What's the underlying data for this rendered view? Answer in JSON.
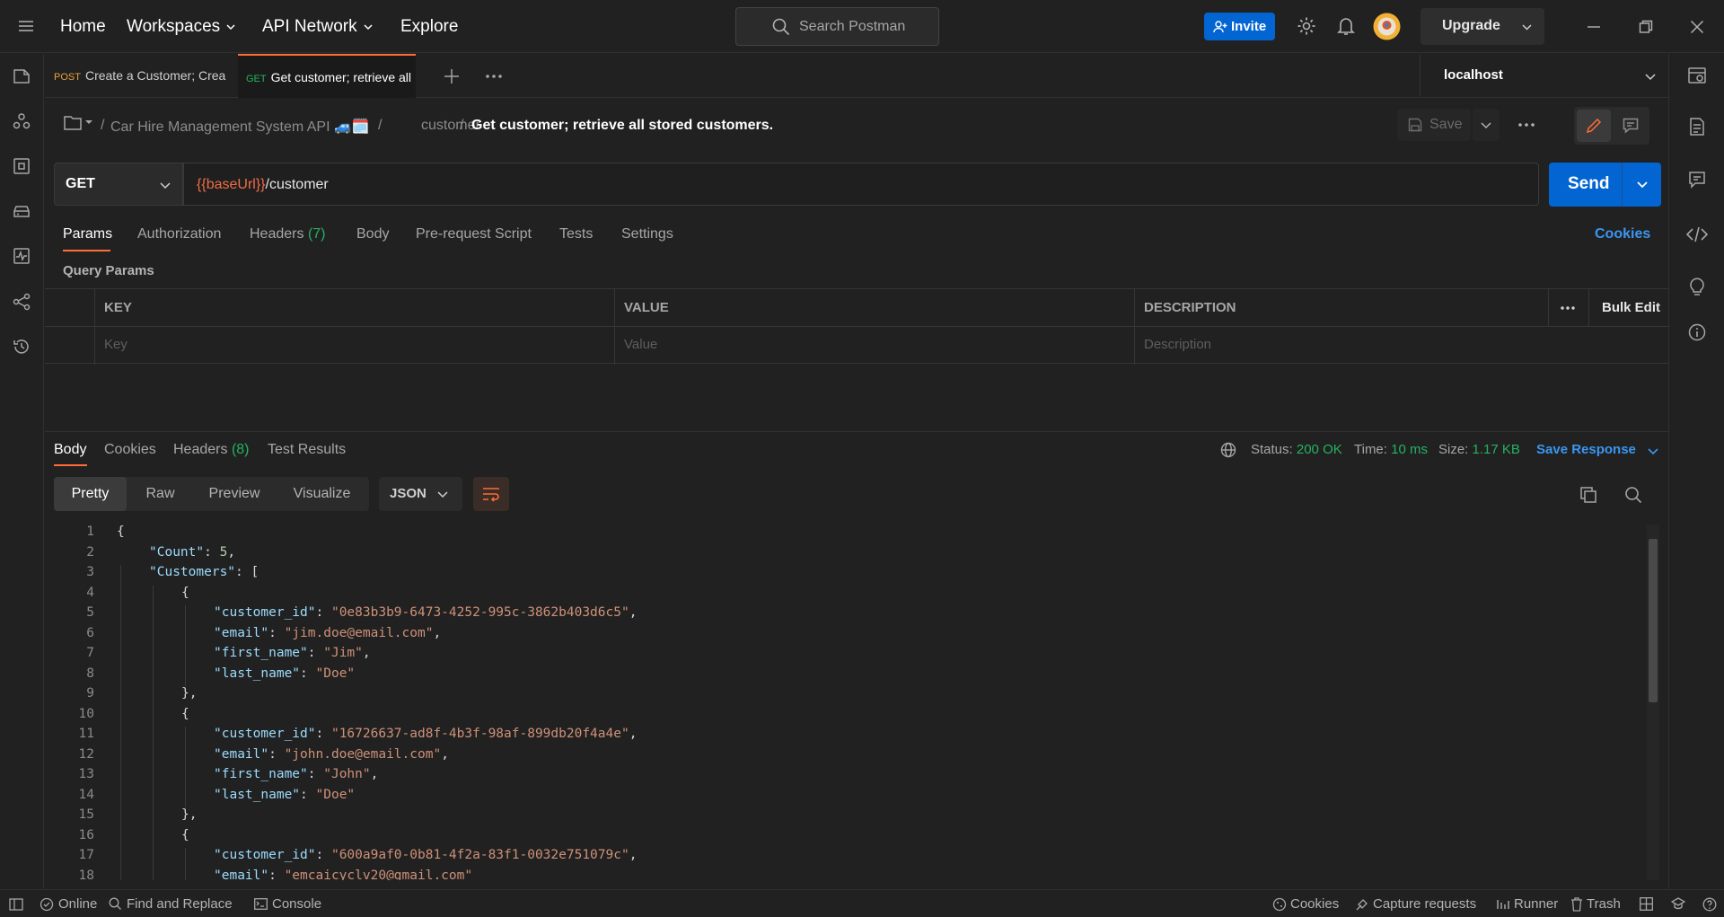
{
  "header": {
    "nav": [
      "Home",
      "Workspaces",
      "API Network",
      "Explore"
    ],
    "search_placeholder": "Search Postman",
    "invite_label": "Invite",
    "upgrade_label": "Upgrade"
  },
  "tabs": [
    {
      "method": "POST",
      "label": "Create a Customer; Crea",
      "method_color": "#e8a03f"
    },
    {
      "method": "GET",
      "label": "Get customer; retrieve all",
      "method_color": "#24b360"
    }
  ],
  "environment": "localhost",
  "breadcrumb": {
    "collection": "Car Hire Management System API 🚙🗓️",
    "folder": "customer",
    "request": "Get customer; retrieve all stored customers."
  },
  "toolbar": {
    "save_label": "Save"
  },
  "request": {
    "method": "GET",
    "url_var": "{{baseUrl}}",
    "url_path": "/customer",
    "send_label": "Send"
  },
  "request_tabs": [
    "Params",
    "Authorization",
    "Headers",
    "(7)",
    "Body",
    "Pre-request Script",
    "Tests",
    "Settings"
  ],
  "cookies_link": "Cookies",
  "params": {
    "title": "Query Params",
    "headers": [
      "KEY",
      "VALUE",
      "DESCRIPTION"
    ],
    "bulk_edit": "Bulk Edit",
    "placeholders": [
      "Key",
      "Value",
      "Description"
    ]
  },
  "response": {
    "tabs": [
      "Body",
      "Cookies",
      "Headers",
      "(8)",
      "Test Results"
    ],
    "status_label": "Status:",
    "status_value": "200 OK",
    "time_label": "Time:",
    "time_value": "10 ms",
    "size_label": "Size:",
    "size_value": "1.17 KB",
    "save_response": "Save Response",
    "views": [
      "Pretty",
      "Raw",
      "Preview",
      "Visualize"
    ],
    "format": "JSON"
  },
  "code_lines": [
    {
      "n": "1",
      "indent": 0,
      "parts": [
        [
          "p",
          "{"
        ]
      ]
    },
    {
      "n": "2",
      "indent": 1,
      "parts": [
        [
          "k",
          "\"Count\""
        ],
        [
          "p",
          ": "
        ],
        [
          "n",
          "5"
        ],
        [
          "p",
          ","
        ]
      ]
    },
    {
      "n": "3",
      "indent": 1,
      "parts": [
        [
          "k",
          "\"Customers\""
        ],
        [
          "p",
          ": ["
        ]
      ]
    },
    {
      "n": "4",
      "indent": 2,
      "parts": [
        [
          "p",
          "{"
        ]
      ]
    },
    {
      "n": "5",
      "indent": 3,
      "parts": [
        [
          "k",
          "\"customer_id\""
        ],
        [
          "p",
          ": "
        ],
        [
          "s",
          "\"0e83b3b9-6473-4252-995c-3862b403d6c5\""
        ],
        [
          "p",
          ","
        ]
      ]
    },
    {
      "n": "6",
      "indent": 3,
      "parts": [
        [
          "k",
          "\"email\""
        ],
        [
          "p",
          ": "
        ],
        [
          "s",
          "\"jim.doe@email.com\""
        ],
        [
          "p",
          ","
        ]
      ]
    },
    {
      "n": "7",
      "indent": 3,
      "parts": [
        [
          "k",
          "\"first_name\""
        ],
        [
          "p",
          ": "
        ],
        [
          "s",
          "\"Jim\""
        ],
        [
          "p",
          ","
        ]
      ]
    },
    {
      "n": "8",
      "indent": 3,
      "parts": [
        [
          "k",
          "\"last_name\""
        ],
        [
          "p",
          ": "
        ],
        [
          "s",
          "\"Doe\""
        ]
      ]
    },
    {
      "n": "9",
      "indent": 2,
      "parts": [
        [
          "p",
          "},"
        ]
      ]
    },
    {
      "n": "10",
      "indent": 2,
      "parts": [
        [
          "p",
          "{"
        ]
      ]
    },
    {
      "n": "11",
      "indent": 3,
      "parts": [
        [
          "k",
          "\"customer_id\""
        ],
        [
          "p",
          ": "
        ],
        [
          "s",
          "\"16726637-ad8f-4b3f-98af-899db20f4a4e\""
        ],
        [
          "p",
          ","
        ]
      ]
    },
    {
      "n": "12",
      "indent": 3,
      "parts": [
        [
          "k",
          "\"email\""
        ],
        [
          "p",
          ": "
        ],
        [
          "s",
          "\"john.doe@email.com\""
        ],
        [
          "p",
          ","
        ]
      ]
    },
    {
      "n": "13",
      "indent": 3,
      "parts": [
        [
          "k",
          "\"first_name\""
        ],
        [
          "p",
          ": "
        ],
        [
          "s",
          "\"John\""
        ],
        [
          "p",
          ","
        ]
      ]
    },
    {
      "n": "14",
      "indent": 3,
      "parts": [
        [
          "k",
          "\"last_name\""
        ],
        [
          "p",
          ": "
        ],
        [
          "s",
          "\"Doe\""
        ]
      ]
    },
    {
      "n": "15",
      "indent": 2,
      "parts": [
        [
          "p",
          "},"
        ]
      ]
    },
    {
      "n": "16",
      "indent": 2,
      "parts": [
        [
          "p",
          "{"
        ]
      ]
    },
    {
      "n": "17",
      "indent": 3,
      "parts": [
        [
          "k",
          "\"customer_id\""
        ],
        [
          "p",
          ": "
        ],
        [
          "s",
          "\"600a9af0-0b81-4f2a-83f1-0032e751079c\""
        ],
        [
          "p",
          ","
        ]
      ]
    },
    {
      "n": "18",
      "indent": 3,
      "parts": [
        [
          "k",
          "\"email\""
        ],
        [
          "p",
          ": "
        ],
        [
          "s",
          "\"emcaicyclv20@gmail.com\""
        ]
      ]
    }
  ],
  "statusbar": {
    "online": "Online",
    "find_replace": "Find and Replace",
    "console": "Console",
    "cookies": "Cookies",
    "capture": "Capture requests",
    "runner": "Runner",
    "trash": "Trash"
  },
  "colors": {
    "accent": "#ff6c37",
    "primary_button": "#0265d2",
    "status_ok": "#24b360",
    "json_key": "#9cdcfe",
    "json_string": "#ce9178",
    "json_number": "#b5cea8"
  },
  "icons": [
    "menu-icon",
    "search-icon",
    "settings-icon",
    "bell-icon",
    "avatar",
    "minimize-icon",
    "restore-icon",
    "close-icon",
    "collections-icon",
    "apis-icon",
    "environments-icon",
    "mock-servers-icon",
    "monitors-icon",
    "flows-icon",
    "history-icon",
    "plus-icon",
    "more-icon",
    "env-quicklook-icon",
    "docs-icon",
    "comments-icon",
    "code-icon",
    "lightbulb-icon",
    "info-icon",
    "globe-icon",
    "copy-icon",
    "wrap-icon"
  ]
}
